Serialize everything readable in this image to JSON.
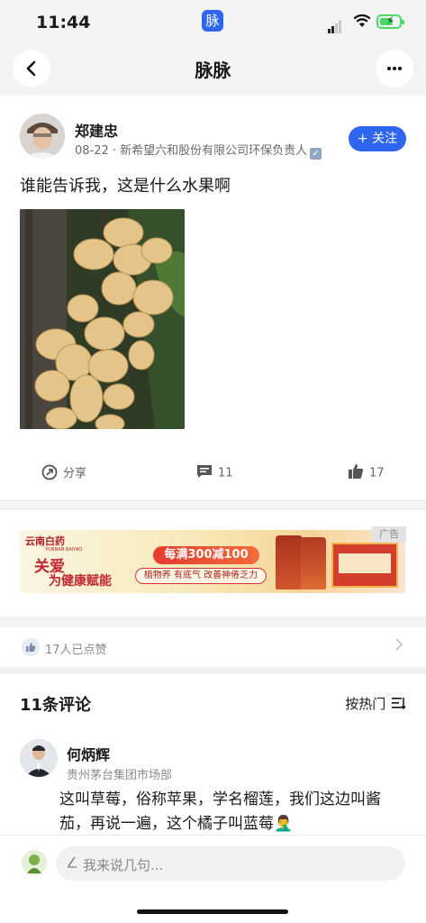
{
  "status_bar": {
    "time": "11:44",
    "app_icon_char": "脉"
  },
  "nav": {
    "title": "脉脉",
    "back_icon": "chevron-left-icon",
    "more_icon": "ellipsis-icon"
  },
  "post": {
    "author": {
      "name": "郑建忠",
      "meta": "08-22 · 新希望六和股份有限公司环保负责人"
    },
    "follow_label": "+ 关注",
    "text": "谁能告诉我，这是什么水果啊",
    "actions": {
      "share_label": "分享",
      "comment_count": "11",
      "like_count": "17"
    }
  },
  "ad": {
    "tag": "广告",
    "brand": "云南白药",
    "brand_en": "YUNNAN BAIYAO",
    "slogan_line1": "关爱",
    "slogan_line2": "为健康赋能",
    "promo": "每满300减100",
    "tagline": "植物养 有底气 改善神倦乏力"
  },
  "likes": {
    "text": "17人已点赞"
  },
  "comments": {
    "title": "11条评论",
    "sort_label": "按热门",
    "items": [
      {
        "name": "何炳辉",
        "org": "贵州茅台集团市场部",
        "text": "这叫草莓，俗称苹果，学名榴莲，我们这边叫酱茄，再说一遍，这个橘子叫蓝莓🤦‍♂️"
      }
    ]
  },
  "composer": {
    "placeholder": "我来说几句..."
  },
  "colors": {
    "accent": "#2f66f0",
    "background": "#f2f3f5",
    "card": "#ffffff"
  }
}
